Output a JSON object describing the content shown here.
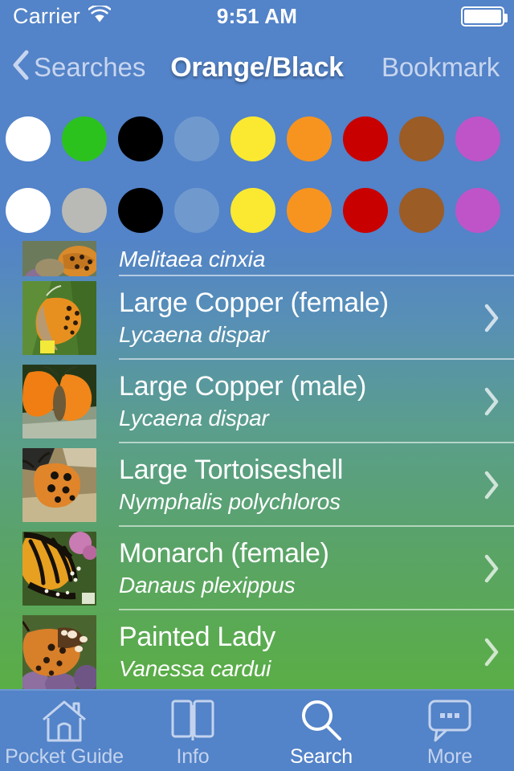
{
  "status_bar": {
    "carrier": "Carrier",
    "wifi_icon": "wifi-icon",
    "time": "9:51 AM",
    "battery_icon": "battery-full-icon"
  },
  "nav_bar": {
    "back_icon": "chevron-left-icon",
    "back_label": "Searches",
    "title": "Orange/Black",
    "right_label": "Bookmark"
  },
  "color_filter": {
    "rows": [
      {
        "name": "color-row-primary",
        "swatches": [
          {
            "name": "swatch-white",
            "color": "#ffffff"
          },
          {
            "name": "swatch-green",
            "color": "#2cc21e"
          },
          {
            "name": "swatch-black",
            "color": "#000000"
          },
          {
            "name": "swatch-blue",
            "color": "#7099ce"
          },
          {
            "name": "swatch-yellow",
            "color": "#fbe931"
          },
          {
            "name": "swatch-orange",
            "color": "#f79420"
          },
          {
            "name": "swatch-red",
            "color": "#c90000"
          },
          {
            "name": "swatch-brown",
            "color": "#9b5c26"
          },
          {
            "name": "swatch-purple",
            "color": "#bf54c9"
          }
        ]
      },
      {
        "name": "color-row-secondary",
        "swatches": [
          {
            "name": "swatch-white",
            "color": "#ffffff"
          },
          {
            "name": "swatch-grey",
            "color": "#b9bab5"
          },
          {
            "name": "swatch-black",
            "color": "#000000"
          },
          {
            "name": "swatch-blue",
            "color": "#7099ce"
          },
          {
            "name": "swatch-yellow",
            "color": "#fbe931"
          },
          {
            "name": "swatch-orange",
            "color": "#f79420"
          },
          {
            "name": "swatch-red",
            "color": "#c90000"
          },
          {
            "name": "swatch-brown",
            "color": "#9b5c26"
          },
          {
            "name": "swatch-purple",
            "color": "#bf54c9"
          }
        ]
      }
    ]
  },
  "results": {
    "gradient_start": "#5383c8",
    "gradient_end": "#5aae45",
    "disclosure_icon": "chevron-right-icon",
    "items": [
      {
        "common_name": "",
        "latin_name": "Melitaea cinxia",
        "partial": true
      },
      {
        "common_name": "Large Copper (female)",
        "latin_name": "Lycaena dispar",
        "partial": false
      },
      {
        "common_name": "Large Copper (male)",
        "latin_name": "Lycaena dispar",
        "partial": false
      },
      {
        "common_name": "Large Tortoiseshell",
        "latin_name": "Nymphalis polychloros",
        "partial": false
      },
      {
        "common_name": "Monarch (female)",
        "latin_name": "Danaus plexippus",
        "partial": false
      },
      {
        "common_name": "Painted Lady",
        "latin_name": "Vanessa cardui",
        "partial": false
      }
    ]
  },
  "tab_bar": {
    "tabs": [
      {
        "label": "Pocket Guide",
        "icon": "house-icon",
        "active": false
      },
      {
        "label": "Info",
        "icon": "book-icon",
        "active": false
      },
      {
        "label": "Search",
        "icon": "magnifier-icon",
        "active": true
      },
      {
        "label": "More",
        "icon": "speech-bubble-icon",
        "active": false
      }
    ]
  }
}
